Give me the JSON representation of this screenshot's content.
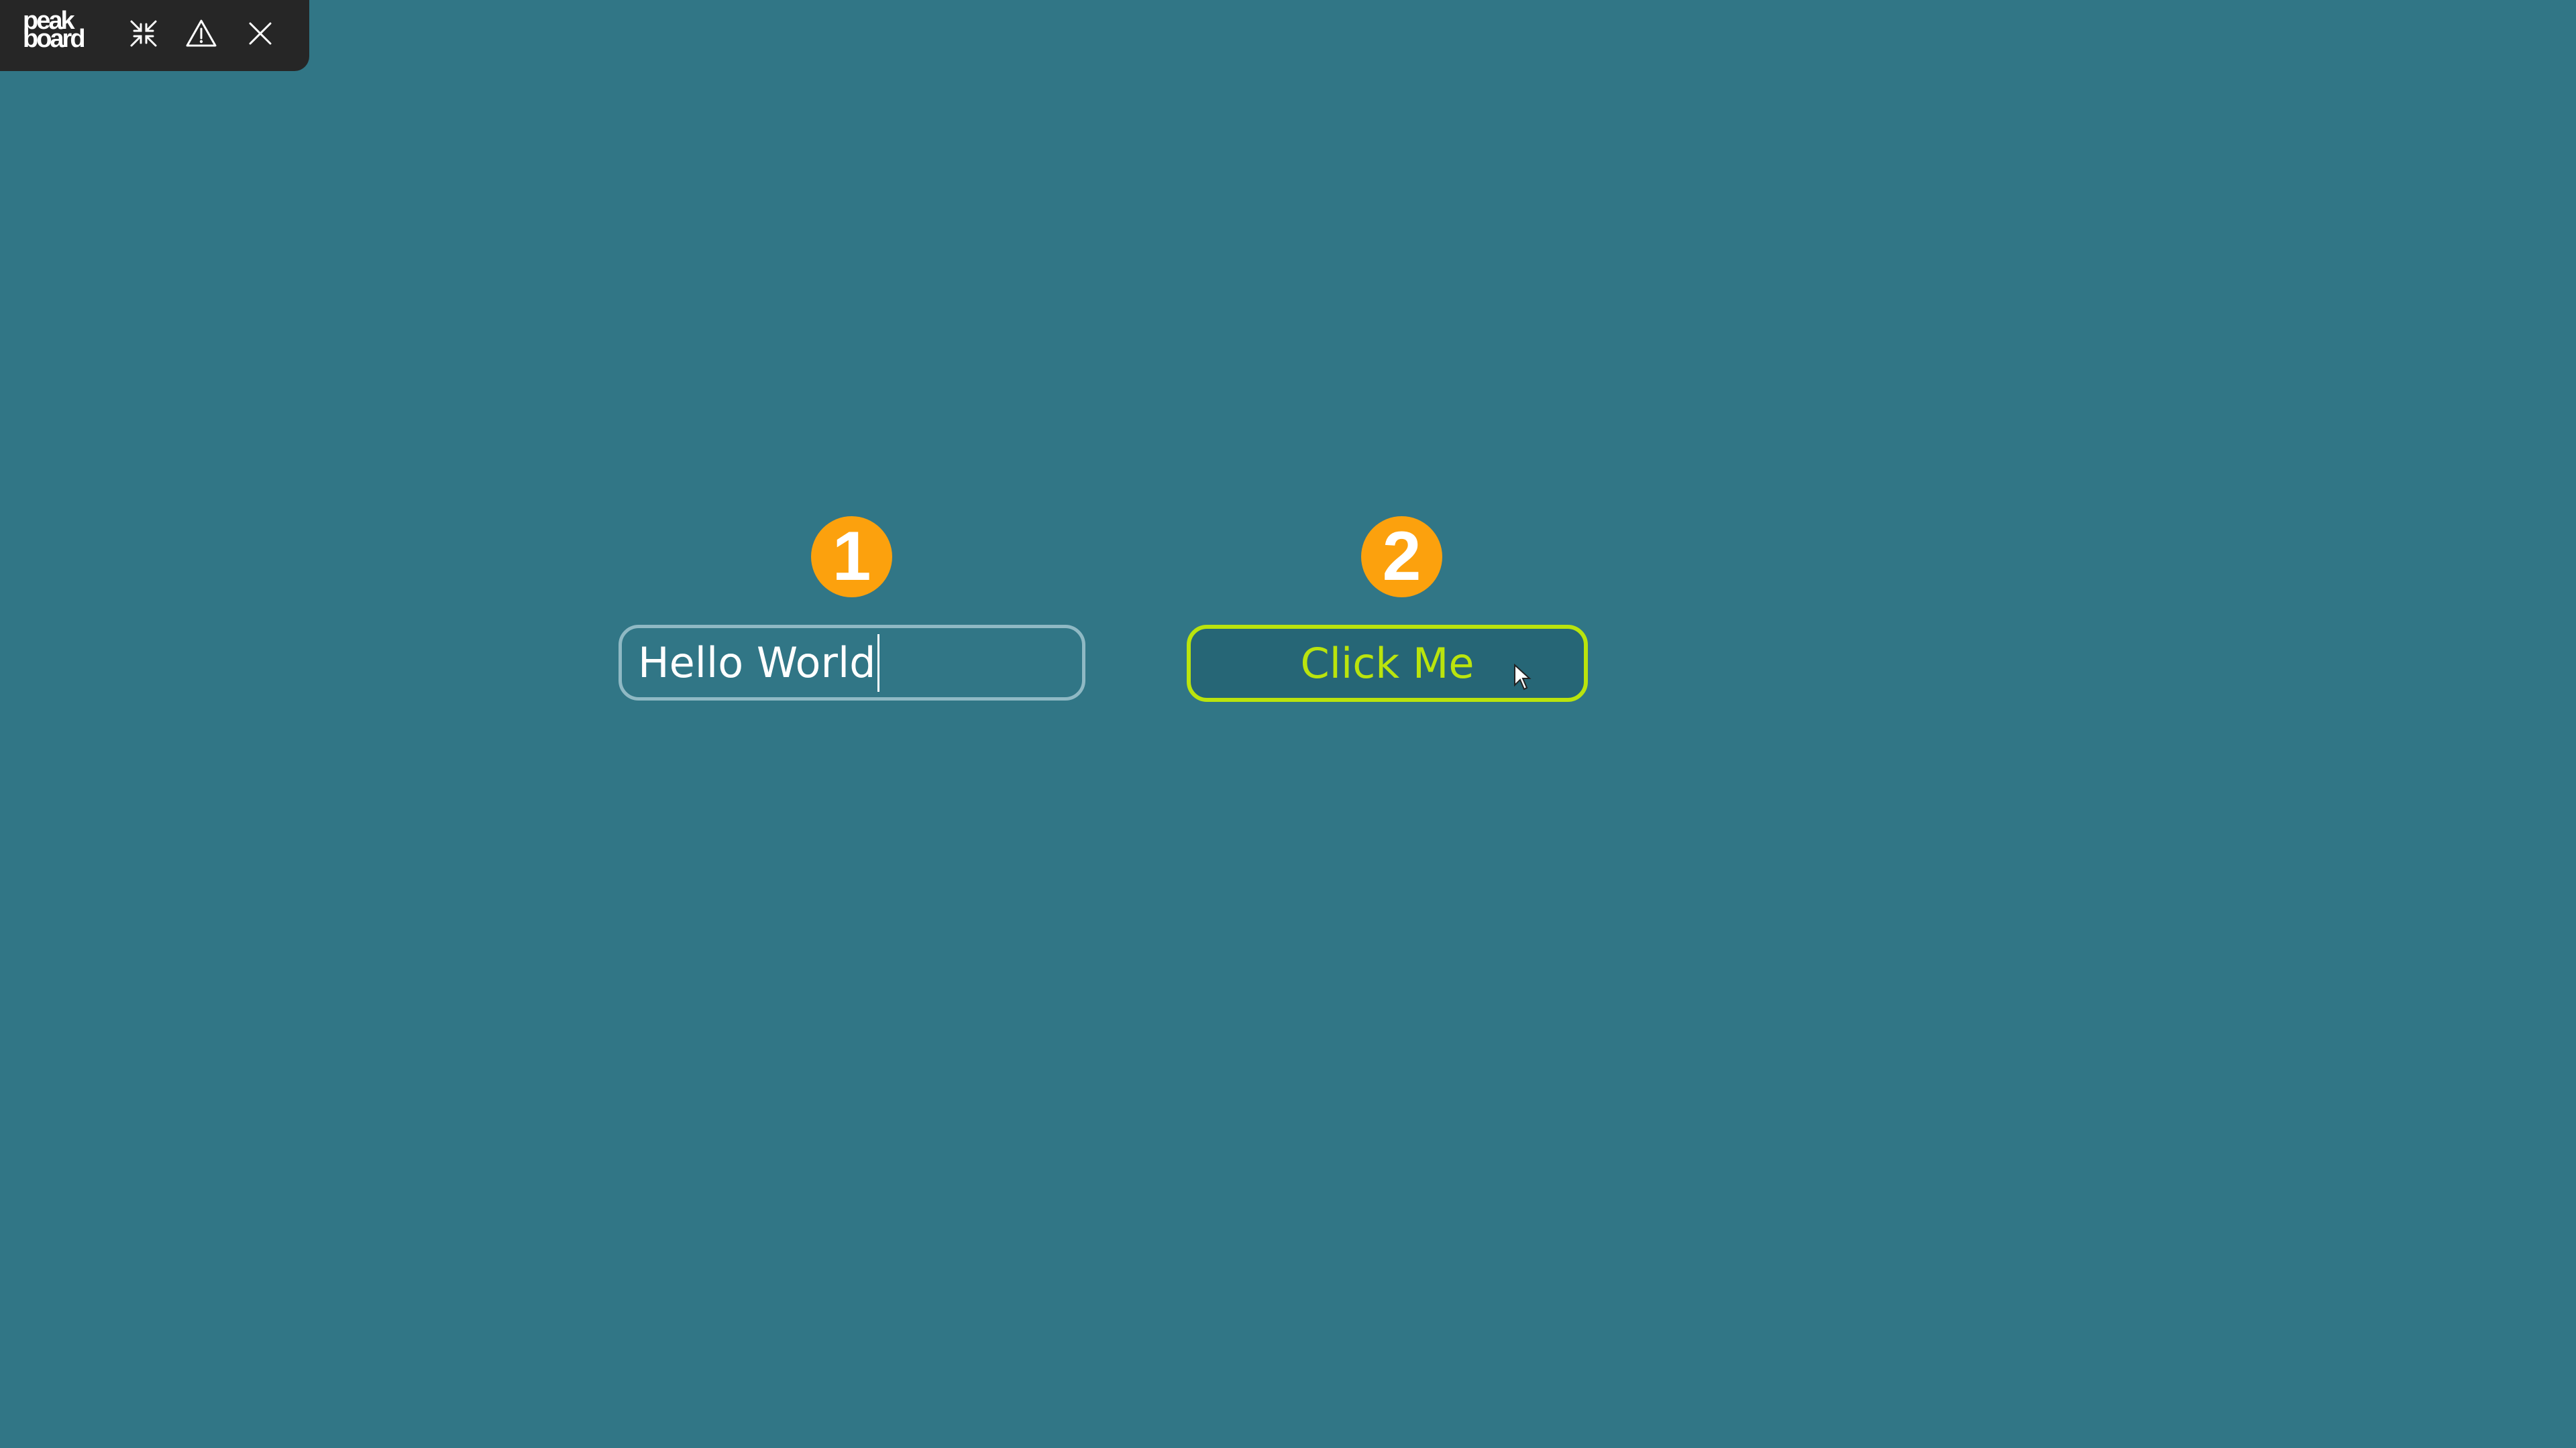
{
  "app": {
    "logo_line1": "peak",
    "logo_line2": "board"
  },
  "toolbar": {
    "buttons": [
      {
        "icon": "collapse-icon"
      },
      {
        "icon": "warning-icon"
      },
      {
        "icon": "close-icon"
      }
    ]
  },
  "callouts": {
    "first": "1",
    "second": "2"
  },
  "textbox": {
    "value": "Hello World"
  },
  "button": {
    "label": "Click Me"
  },
  "colors": {
    "background": "#317686",
    "toolbar": "#262626",
    "badge": "#fca10d",
    "button_border": "#bae40d",
    "button_text": "#bae40d",
    "button_fill": "#266676",
    "textbox_border": "#8fb9c4"
  }
}
